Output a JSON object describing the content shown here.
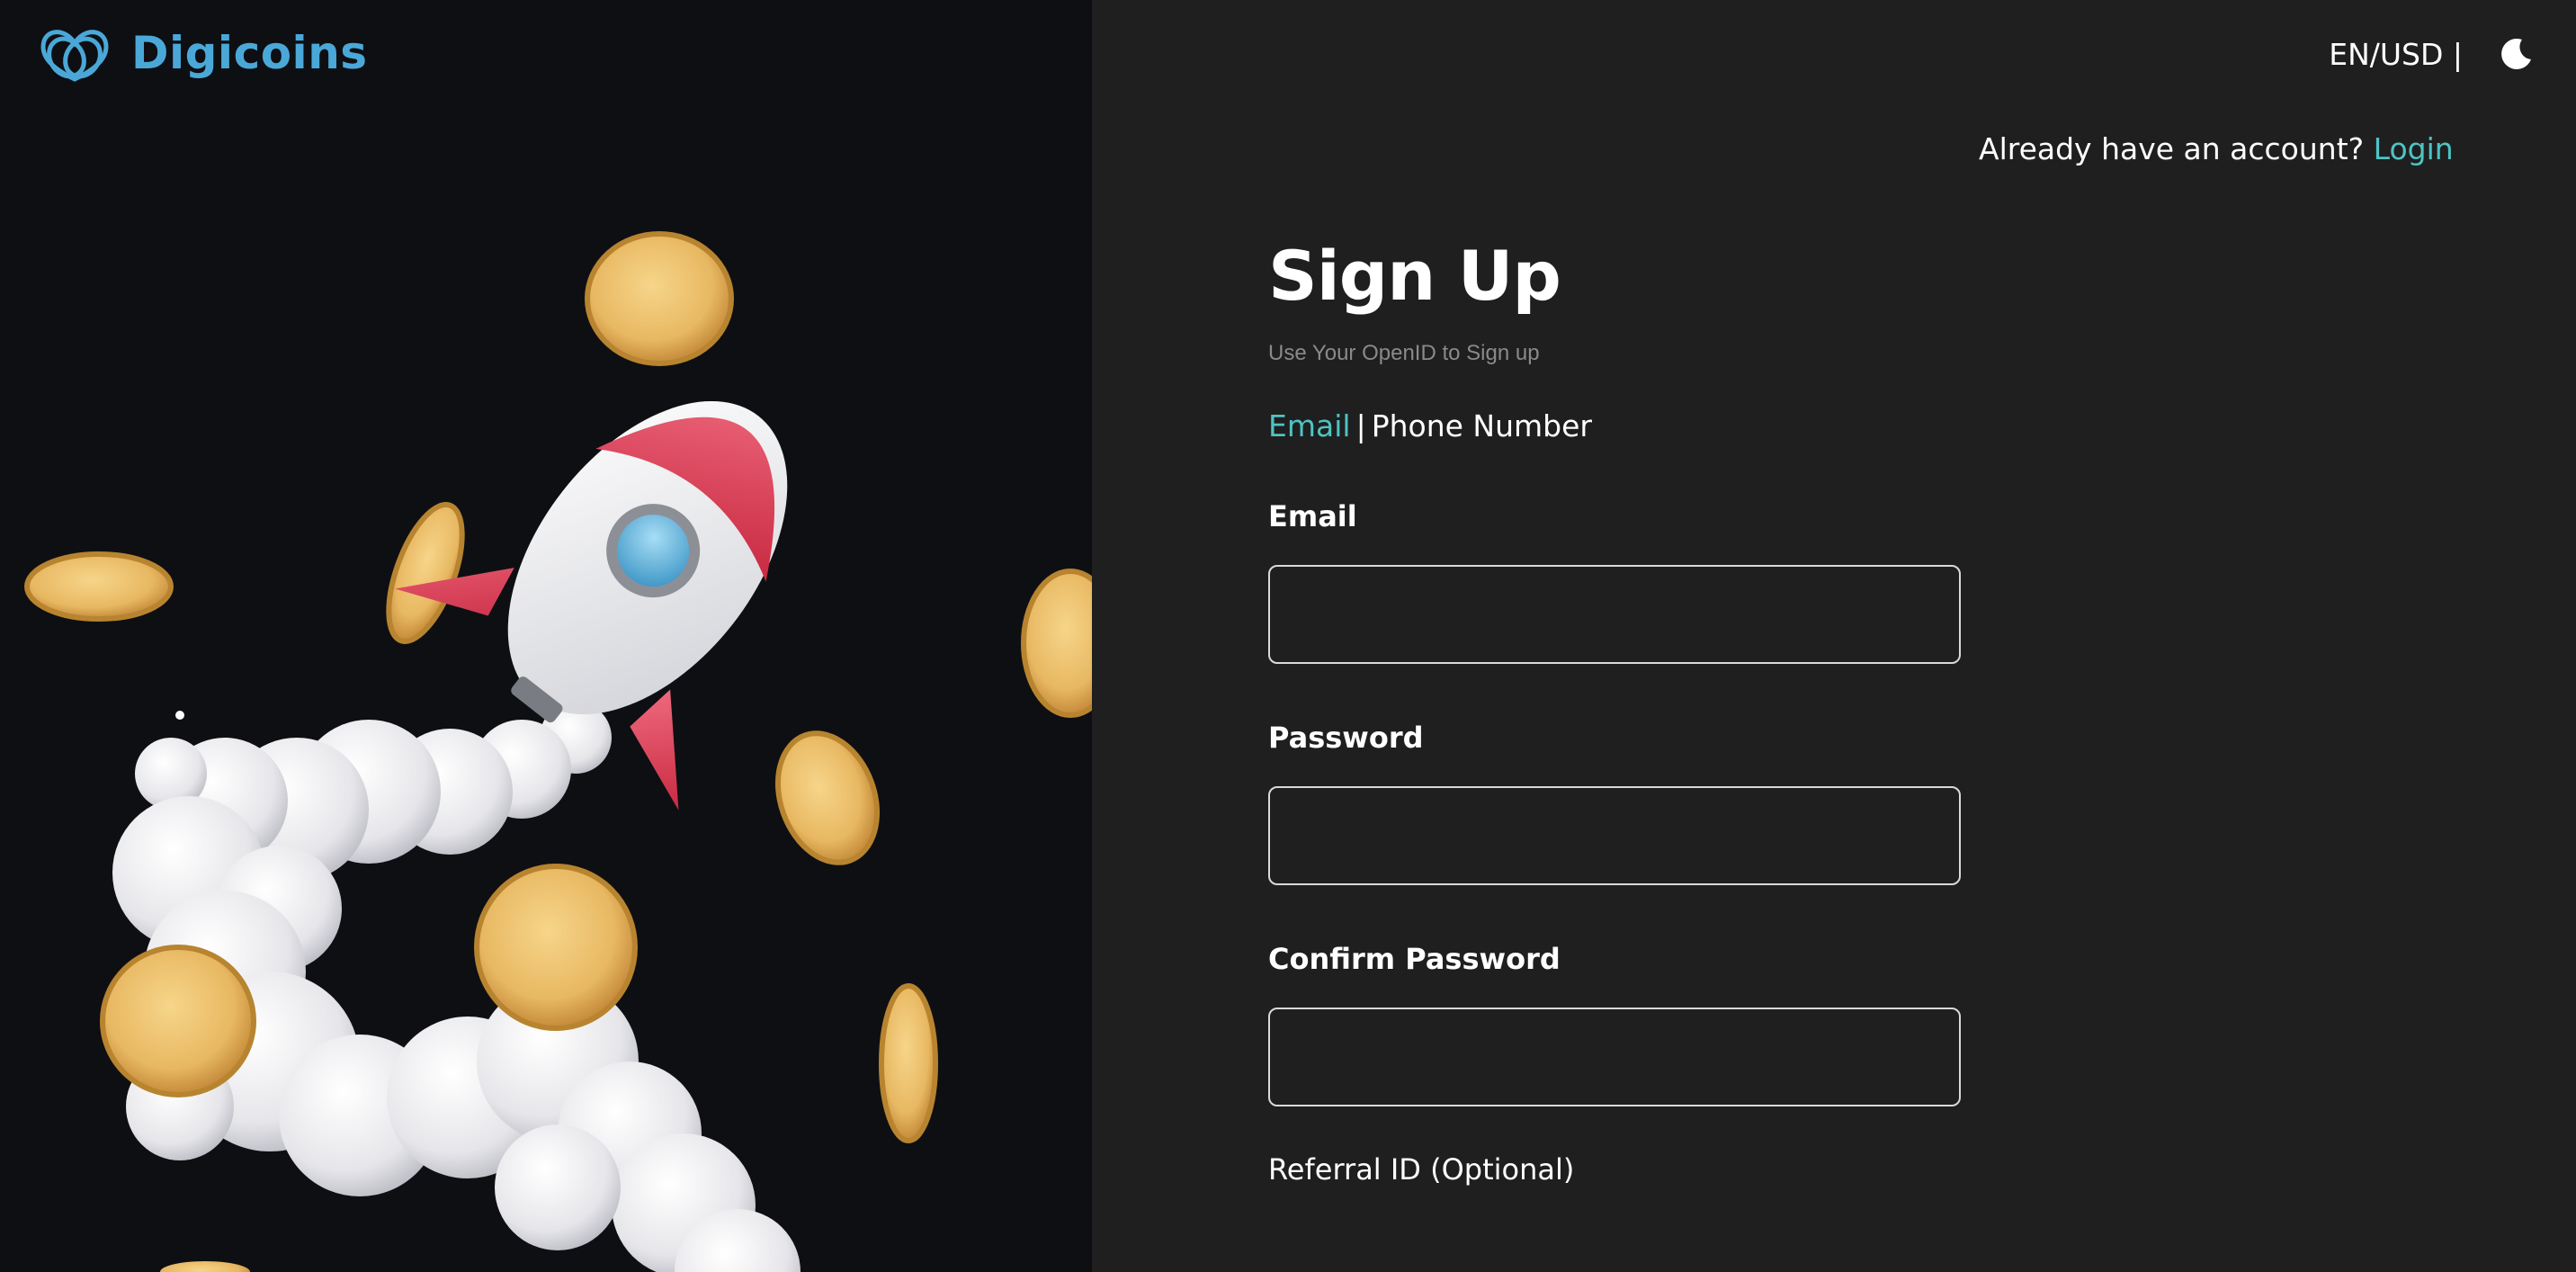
{
  "brand": {
    "name": "Digicoins",
    "logo_icon": "digicoins-logo-icon",
    "color": "#4aa8d8"
  },
  "topbar": {
    "locale_label": "EN/USD |",
    "theme_icon": "moon-icon"
  },
  "account_prompt": {
    "text": "Already have an account?",
    "login_label": "Login"
  },
  "form": {
    "title": "Sign Up",
    "subtitle": "Use Your OpenID to Sign up",
    "methods": {
      "email_label": "Email",
      "separator": "|",
      "phone_label": "Phone Number",
      "active": "email"
    },
    "fields": {
      "email": {
        "label": "Email",
        "value": "",
        "placeholder": ""
      },
      "password": {
        "label": "Password",
        "value": "",
        "placeholder": ""
      },
      "confirm_password": {
        "label": "Confirm Password",
        "value": "",
        "placeholder": ""
      }
    },
    "referral_label": "Referral ID (Optional)"
  },
  "colors": {
    "accent": "#4fc3c3",
    "panel_left": "#0e0f13",
    "panel_right": "#1f1f1f",
    "subtitle": "#8a8a8a"
  },
  "hero": {
    "illustration": "rocket-with-coins-illustration"
  }
}
